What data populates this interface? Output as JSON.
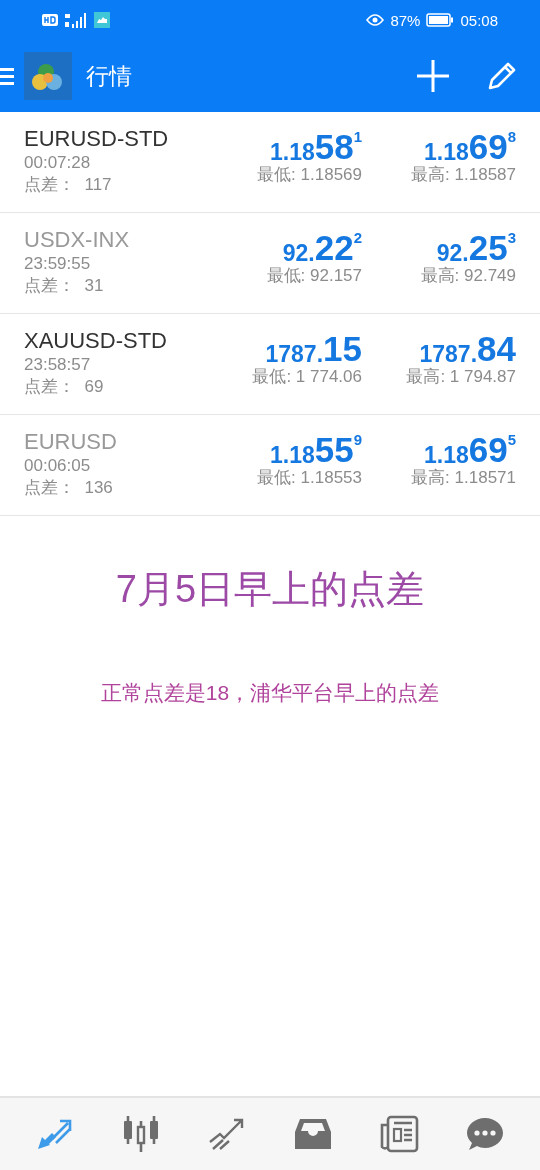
{
  "status_bar": {
    "battery": "87%",
    "time": "05:08"
  },
  "header": {
    "title": "行情"
  },
  "quotes": [
    {
      "symbol": "EURUSD-STD",
      "active": true,
      "time": "00:07:28",
      "spread_label": "点差：",
      "spread": "117",
      "bid": {
        "pre": "1.18",
        "big": "58",
        "sup": "1"
      },
      "ask": {
        "pre": "1.18",
        "big": "69",
        "sup": "8"
      },
      "low": "最低: 1.18569",
      "high": "最高: 1.18587"
    },
    {
      "symbol": "USDX-INX",
      "active": false,
      "time": "23:59:55",
      "spread_label": "点差：",
      "spread": "31",
      "bid": {
        "pre": "92.",
        "big": "22",
        "sup": "2"
      },
      "ask": {
        "pre": "92.",
        "big": "25",
        "sup": "3"
      },
      "low": "最低: 92.157",
      "high": "最高: 92.749"
    },
    {
      "symbol": "XAUUSD-STD",
      "active": true,
      "time": "23:58:57",
      "spread_label": "点差：",
      "spread": "69",
      "bid": {
        "pre": "1787.",
        "big": "15"
      },
      "ask": {
        "pre": "1787.",
        "big": "84"
      },
      "low": "最低: 1 774.06",
      "high": "最高: 1 794.87"
    },
    {
      "symbol": "EURUSD",
      "active": false,
      "time": "00:06:05",
      "spread_label": "点差：",
      "spread": "136",
      "bid": {
        "pre": "1.18",
        "big": "55",
        "sup": "9"
      },
      "ask": {
        "pre": "1.18",
        "big": "69",
        "sup": "5"
      },
      "low": "最低: 1.18553",
      "high": "最高: 1.18571"
    }
  ],
  "annotation": {
    "heading": "7月5日早上的点差",
    "note": "正常点差是18，浦华平台早上的点差"
  },
  "bottom_nav": [
    {
      "kind": "quotes",
      "selected": true
    },
    {
      "kind": "chart",
      "selected": false
    },
    {
      "kind": "trade",
      "selected": false
    },
    {
      "kind": "history",
      "selected": false
    },
    {
      "kind": "news",
      "selected": false
    },
    {
      "kind": "chat",
      "selected": false
    }
  ]
}
